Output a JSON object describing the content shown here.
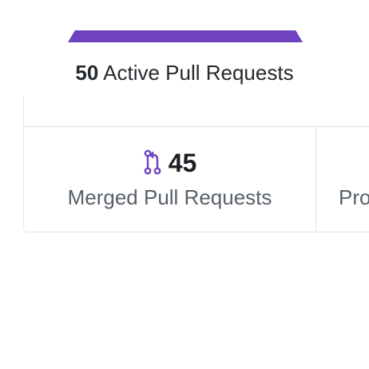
{
  "summary": {
    "active_count": "50",
    "active_label": "Active Pull Requests"
  },
  "stats": {
    "merged": {
      "icon": "git-merge-icon",
      "value": "45",
      "label": "Merged Pull Requests"
    },
    "next": {
      "label": "Pro"
    }
  },
  "colors": {
    "accent": "#6f42c1",
    "text": "#24292e",
    "muted": "#586069",
    "border": "#e1e4e8"
  }
}
